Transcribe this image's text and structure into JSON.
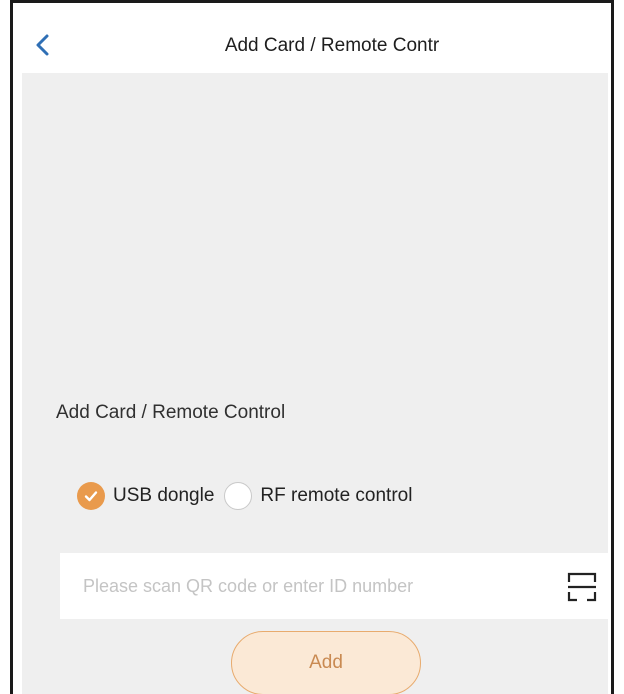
{
  "header": {
    "title": "Add Card / Remote Contr",
    "back_icon": "chevron-left-icon"
  },
  "section": {
    "label": "Add Card / Remote Control"
  },
  "connection_type": {
    "options": [
      {
        "label": "USB dongle",
        "selected": true
      },
      {
        "label": "RF remote control",
        "selected": false
      }
    ]
  },
  "id_input": {
    "value": "",
    "placeholder": "Please scan QR code or enter ID number",
    "scan_icon": "scan-icon"
  },
  "actions": {
    "add_label": "Add"
  },
  "colors": {
    "accent": "#e99a4c",
    "back_arrow": "#2f6fb5",
    "content_bg": "#efefef",
    "add_button_bg": "#fbe9d6",
    "add_button_text": "#c98a52"
  }
}
